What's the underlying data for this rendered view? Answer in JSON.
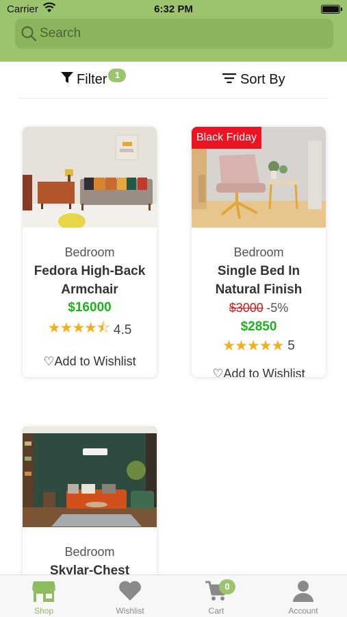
{
  "status_bar": {
    "carrier": "Carrier",
    "time": "6:32 PM"
  },
  "search": {
    "placeholder": "Search",
    "value": ""
  },
  "toolbar": {
    "filter_label": "Filter",
    "filter_count": "1",
    "sort_label": "Sort By"
  },
  "products": [
    {
      "category": "Bedroom",
      "name": "Fedora High-Back Armchair",
      "price": "$16000",
      "stars": "★★★★⯪",
      "rating": "4.5",
      "wishlist_label": "Add to Wishlist",
      "image": "living-room-sofa-image"
    },
    {
      "category": "Bedroom",
      "name": "Single Bed In Natural Finish",
      "tag": "Black Friday",
      "original_price": "$3000",
      "discount": "-5%",
      "price": "$2850",
      "stars": "★★★★★",
      "rating": "5",
      "wishlist_label": "Add to Wishlist",
      "image": "pink-armchair-image"
    },
    {
      "category": "Bedroom",
      "name": "Skylar-Chest",
      "image": "green-living-room-image"
    }
  ],
  "tabs": [
    {
      "label": "Shop",
      "icon": "shop-icon",
      "active": true
    },
    {
      "label": "Wishlist",
      "icon": "heart-icon"
    },
    {
      "label": "Cart",
      "icon": "cart-icon",
      "badge": "0"
    },
    {
      "label": "Account",
      "icon": "person-icon"
    }
  ],
  "colors": {
    "accent": "#9cc46c",
    "price_green": "#1fb21f",
    "sale_red": "#ee1320",
    "star": "#f2b01e"
  }
}
